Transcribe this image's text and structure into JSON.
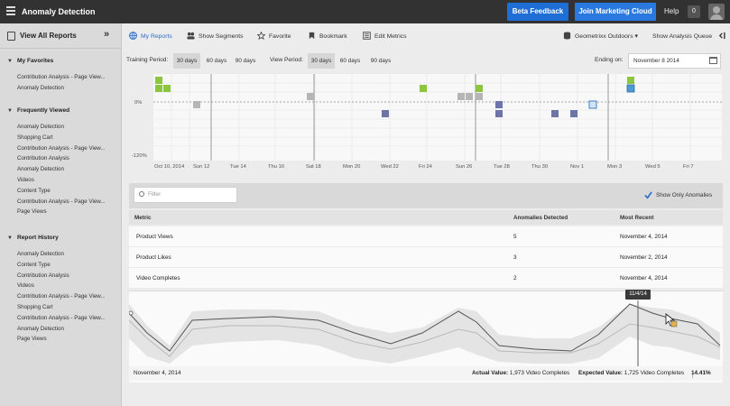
{
  "app": {
    "title": "Anomaly Detection",
    "beta_button": "Beta Feedback",
    "join_button": "Join Marketing Cloud",
    "help": "Help",
    "notification_count": "0"
  },
  "sidebar": {
    "view_all": "View All Reports",
    "sections": [
      {
        "title": "My Favorites",
        "items": [
          "Contribution Analysis - Page View...",
          "Anomaly Detection"
        ]
      },
      {
        "title": "Frequently Viewed",
        "items": [
          "Anomaly Detection",
          "Shopping Cart",
          "Contribution Analysis - Page View...",
          "Contribution Analysis",
          "Anomaly Detection",
          "Videos",
          "Content Type",
          "Contribution Analysis - Page View...",
          "Page Views"
        ]
      },
      {
        "title": "Report History",
        "items": [
          "Anomaly Detection",
          "Content Type",
          "Contribution Analysis",
          "Videos",
          "Contribution Analysis - Page View...",
          "Shopping Cart",
          "Contribution Analysis - Page View...",
          "Anomaly Detection",
          "Page Views"
        ]
      }
    ]
  },
  "toolbar": {
    "my_reports": "My Reports",
    "show_segments": "Show Segments",
    "favorite": "Favorite",
    "bookmark": "Bookmark",
    "edit_metrics": "Edit Metrics",
    "report_suite": "Geometrixx Outdoors",
    "analysis_queue": "Show Analysis Queue"
  },
  "periods": {
    "training_label": "Training Period:",
    "view_label": "View Period:",
    "options": [
      "30 days",
      "60 days",
      "90 days"
    ],
    "training_selected": "30 days",
    "view_selected": "30 days",
    "ending_label": "Ending on:",
    "ending_date": "November 8 2014"
  },
  "anomaly_chart": {
    "y_labels": [
      "0%",
      "-120%"
    ],
    "x_labels": [
      "Oct 10, 2014",
      "Sun 12",
      "Tue 14",
      "Thu 16",
      "Sat 18",
      "Mon 20",
      "Wed 22",
      "Fri 24",
      "Sun 26",
      "Tue 28",
      "Thu 30",
      "Nov 1",
      "Mon 3",
      "Wed 5",
      "Fri 7"
    ],
    "colors": {
      "green": "#8cc63f",
      "gray": "#b5b5b5",
      "blue": "#6b75a8",
      "highlight": "#4d9ad6"
    }
  },
  "filter": {
    "placeholder": "Filter",
    "show_only": "Show Only Anomalies"
  },
  "table": {
    "headers": {
      "metric": "Metric",
      "anomalies": "Anomalies Detected",
      "recent": "Most Recent"
    },
    "rows": [
      {
        "metric": "Product Views",
        "anomalies": "5",
        "recent": "November 4, 2014"
      },
      {
        "metric": "Product Likes",
        "anomalies": "3",
        "recent": "November 2, 2014"
      },
      {
        "metric": "Video Completes",
        "anomalies": "2",
        "recent": "November 4, 2014"
      }
    ]
  },
  "detail": {
    "tooltip": "11/4/14",
    "date": "November 4, 2014",
    "actual_label": "Actual Value:",
    "actual_value": "1,973 Video Completes",
    "expected_label": "Expected Value:",
    "expected_value": "1,725 Video Completes",
    "change": "14.41%"
  }
}
